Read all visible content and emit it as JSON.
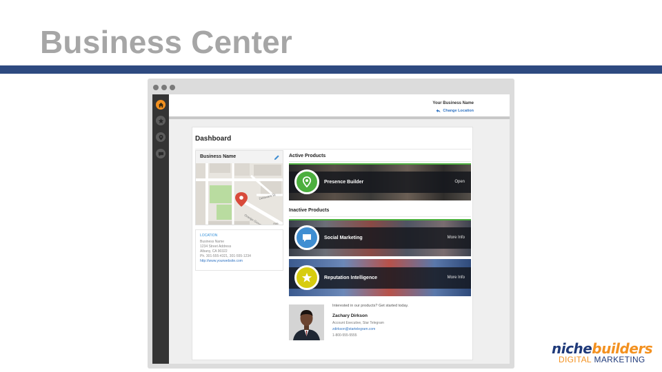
{
  "slide": {
    "title": "Business Center",
    "accent_bar_color": "#2e4a80"
  },
  "topbar": {
    "business_name": "Your Business Name",
    "change_location": "Change Location"
  },
  "sidenav": {
    "items": [
      {
        "icon": "home-icon",
        "active": true
      },
      {
        "icon": "star-icon",
        "active": false
      },
      {
        "icon": "location-pin-icon",
        "active": false
      },
      {
        "icon": "chat-icon",
        "active": false
      }
    ]
  },
  "dashboard": {
    "title": "Dashboard",
    "business_card": {
      "title": "Business Name",
      "map_labels": [
        "Delaware St",
        "Orange Grove Ave",
        "Ave"
      ]
    },
    "location": {
      "label": "LOCATION",
      "name": "Business Name",
      "street": "1234 Street Address",
      "city": "Albany, CA  90322",
      "phone": "Ph. 301-555-4321, 301-555-1234",
      "website": "http://www.yourwebsite.com"
    },
    "active_products_label": "Active Products",
    "inactive_products_label": "Inactive Products",
    "products": {
      "presence": {
        "name": "Presence Builder",
        "action": "Open",
        "icon": "location-pin-icon",
        "color": "#4caf3e"
      },
      "social": {
        "name": "Social Marketing",
        "action": "More Info",
        "icon": "speech-bubble-icon",
        "color": "#3f8ed2"
      },
      "reputation": {
        "name": "Reputation Intelligence",
        "action": "More Info",
        "icon": "star-icon",
        "color": "#d7cc0f"
      }
    },
    "contact": {
      "intro": "Interested in our products? Get started today.",
      "name": "Zachary Dirkson",
      "title": "Account Executive, Star Telegram",
      "email": "zdirkson@startelegram.com",
      "phone": "1-800-555-5555"
    }
  },
  "logo": {
    "niche": "niche",
    "builders": "builders",
    "digital": "DIGITAL",
    "marketing": "MARKETING"
  }
}
